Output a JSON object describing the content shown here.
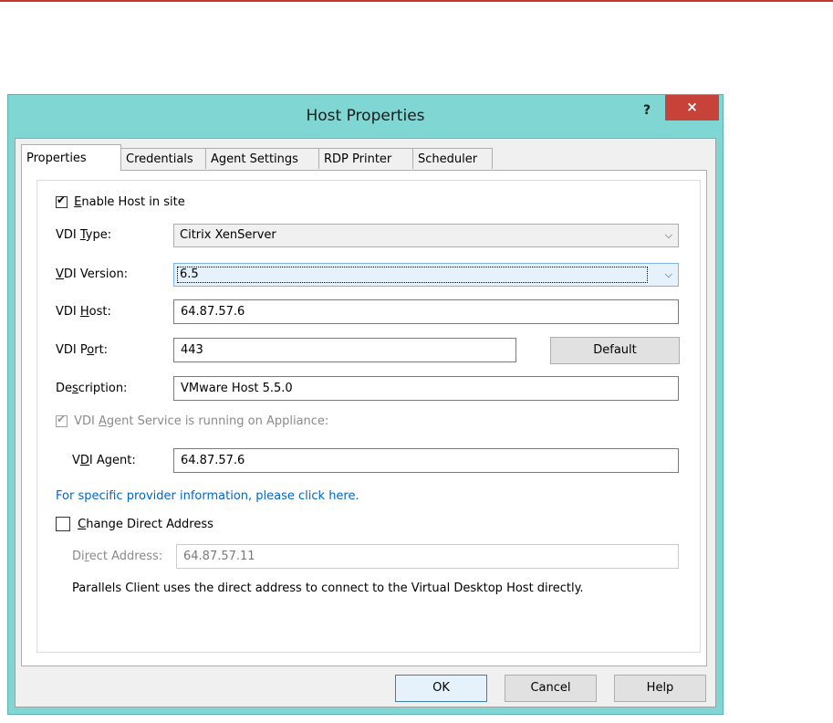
{
  "window": {
    "title": "Host Properties",
    "help_glyph": "?",
    "close_glyph": "×"
  },
  "tabs": [
    {
      "label": "Properties",
      "active": true
    },
    {
      "label": "Credentials",
      "active": false
    },
    {
      "label": "Agent Settings",
      "active": false
    },
    {
      "label": "RDP Printer",
      "active": false
    },
    {
      "label": "Scheduler",
      "active": false
    }
  ],
  "form": {
    "enable_host": {
      "label_u": "E",
      "label_rest": "nable Host in site",
      "checked": true
    },
    "vdi_type": {
      "label_pre": "VDI ",
      "label_u": "T",
      "label_rest": "ype:",
      "value": "Citrix XenServer"
    },
    "vdi_version": {
      "label_u": "V",
      "label_rest": "DI Version:",
      "value": "6.5"
    },
    "vdi_host": {
      "label_pre": "VDI ",
      "label_u": "H",
      "label_rest": "ost:",
      "value": "64.87.57.6"
    },
    "vdi_port": {
      "label_pre": "VDI P",
      "label_u": "o",
      "label_rest": "rt:",
      "value": "443",
      "default_button": "Default"
    },
    "description": {
      "label_pre": "De",
      "label_u": "s",
      "label_rest": "cription:",
      "value": "VMware Host 5.5.0"
    },
    "agent_service": {
      "label_pre": "VDI ",
      "label_u": "A",
      "label_rest": "gent Service is running on Appliance:",
      "checked": true
    },
    "vdi_agent": {
      "label_pre": "V",
      "label_u": "D",
      "label_rest": "I Agent:",
      "value": "64.87.57.6"
    },
    "provider_link": "For specific provider information, please click here.",
    "change_direct": {
      "label_u": "C",
      "label_rest": "hange Direct Address",
      "checked": false
    },
    "direct_address": {
      "label_pre": "Di",
      "label_u": "r",
      "label_rest": "ect Address:",
      "value": "64.87.57.11"
    },
    "direct_note": "Parallels Client uses the direct address to connect to the Virtual Desktop Host directly."
  },
  "buttons": {
    "ok": "OK",
    "cancel": "Cancel",
    "help": "Help"
  },
  "colors": {
    "title_bar": "#7fd6d3",
    "close_button": "#c7433a",
    "link": "#0066cc",
    "top_rule": "#c0392b"
  }
}
